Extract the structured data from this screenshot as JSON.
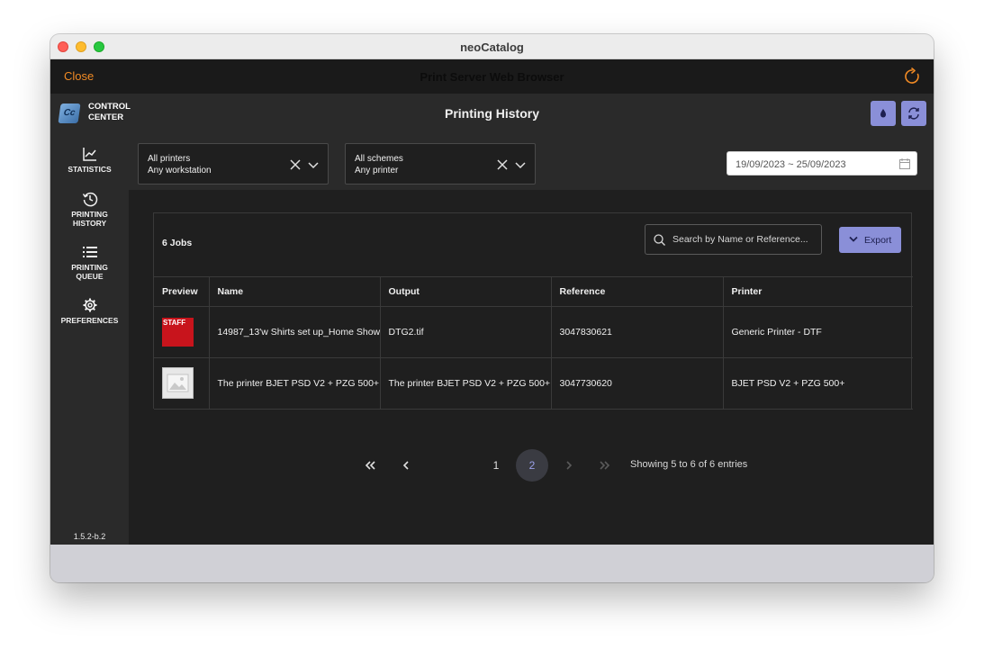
{
  "window": {
    "title": "neoCatalog"
  },
  "topbar": {
    "close_label": "Close",
    "title": "Print Server Web Browser"
  },
  "header": {
    "logo_mark": "Cc",
    "logo_line1": "CONTROL",
    "logo_line2": "CENTER",
    "page_title": "Printing History"
  },
  "sidebar": {
    "items": [
      {
        "label": "STATISTICS",
        "icon": "chart-icon"
      },
      {
        "label_l1": "PRINTING",
        "label_l2": "HISTORY",
        "icon": "history-icon"
      },
      {
        "label_l1": "PRINTING",
        "label_l2": "QUEUE",
        "icon": "list-icon"
      },
      {
        "label": "PREFERENCES",
        "icon": "gear-icon"
      }
    ],
    "version": "1.5.2-b.2"
  },
  "filters": {
    "printers": {
      "line1": "All printers",
      "line2": "Any workstation"
    },
    "schemes": {
      "line1": "All schemes",
      "line2": "Any printer"
    },
    "date_range": "19/09/2023 ~ 25/09/2023"
  },
  "panel": {
    "jobs_count": "6 Jobs",
    "search_placeholder": "Search by Name or Reference...",
    "export_label": "Export"
  },
  "table": {
    "headers": [
      "Preview",
      "Name",
      "Output",
      "Reference",
      "Printer"
    ],
    "rows": [
      {
        "preview": "thumbnail-image",
        "preview_text": "STAFF",
        "name": "14987_13'w Shirts set up_Home Show",
        "output": "DTG2.tif",
        "reference": "3047830621",
        "printer": "Generic Printer - DTF"
      },
      {
        "preview": "placeholder-image",
        "name": "The printer BJET PSD V2 + PZG 500+",
        "output": "The printer BJET PSD V2 + PZG 500+",
        "reference": "3047730620",
        "printer": "BJET PSD V2 + PZG 500+"
      }
    ]
  },
  "pagination": {
    "pages": [
      "1",
      "2"
    ],
    "current": "2",
    "showing": "Showing 5 to 6 of 6 entries"
  },
  "colors": {
    "accent": "#8a8fd8",
    "close_orange": "#f08a24",
    "background": "#1f1f1f",
    "panel": "#2a2a2a"
  }
}
